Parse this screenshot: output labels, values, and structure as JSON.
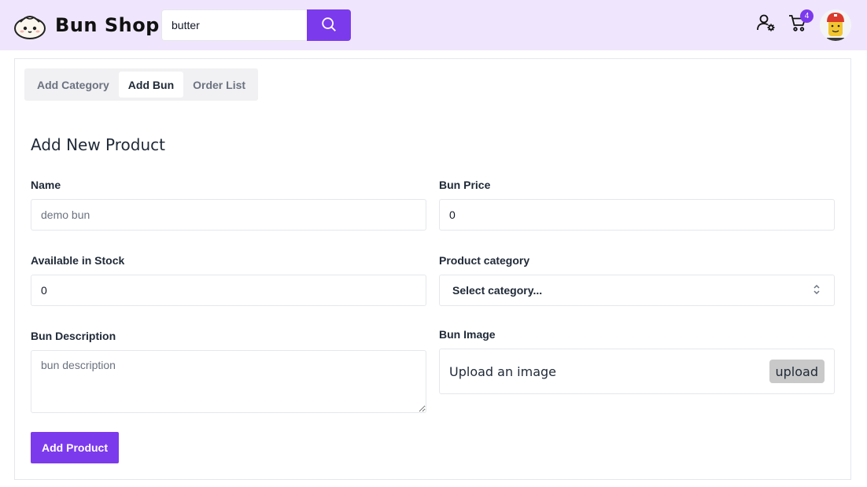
{
  "brand": {
    "name": "Bun Shop",
    "logo_icon": "bun-logo-icon"
  },
  "search": {
    "value": "butter",
    "icon": "search-icon"
  },
  "header": {
    "user_settings_icon": "user-settings-icon",
    "cart_icon": "cart-icon",
    "cart_count": "4",
    "avatar_icon": "avatar-lego-icon"
  },
  "tabs": [
    {
      "label": "Add Category",
      "active": false
    },
    {
      "label": "Add Bun",
      "active": true
    },
    {
      "label": "Order List",
      "active": false
    }
  ],
  "form": {
    "title": "Add New Product",
    "name": {
      "label": "Name",
      "placeholder": "demo bun",
      "value": ""
    },
    "price": {
      "label": "Bun Price",
      "value": "0"
    },
    "stock": {
      "label": "Available in Stock",
      "value": "0"
    },
    "category": {
      "label": "Product category",
      "selected": "Select category..."
    },
    "description": {
      "label": "Bun Description",
      "placeholder": "bun description"
    },
    "image": {
      "label": "Bun Image",
      "prompt": "Upload an image",
      "button": "upload"
    },
    "submit": "Add Product"
  },
  "colors": {
    "accent": "#7c3aed",
    "header_bg": "#efe6fd"
  }
}
